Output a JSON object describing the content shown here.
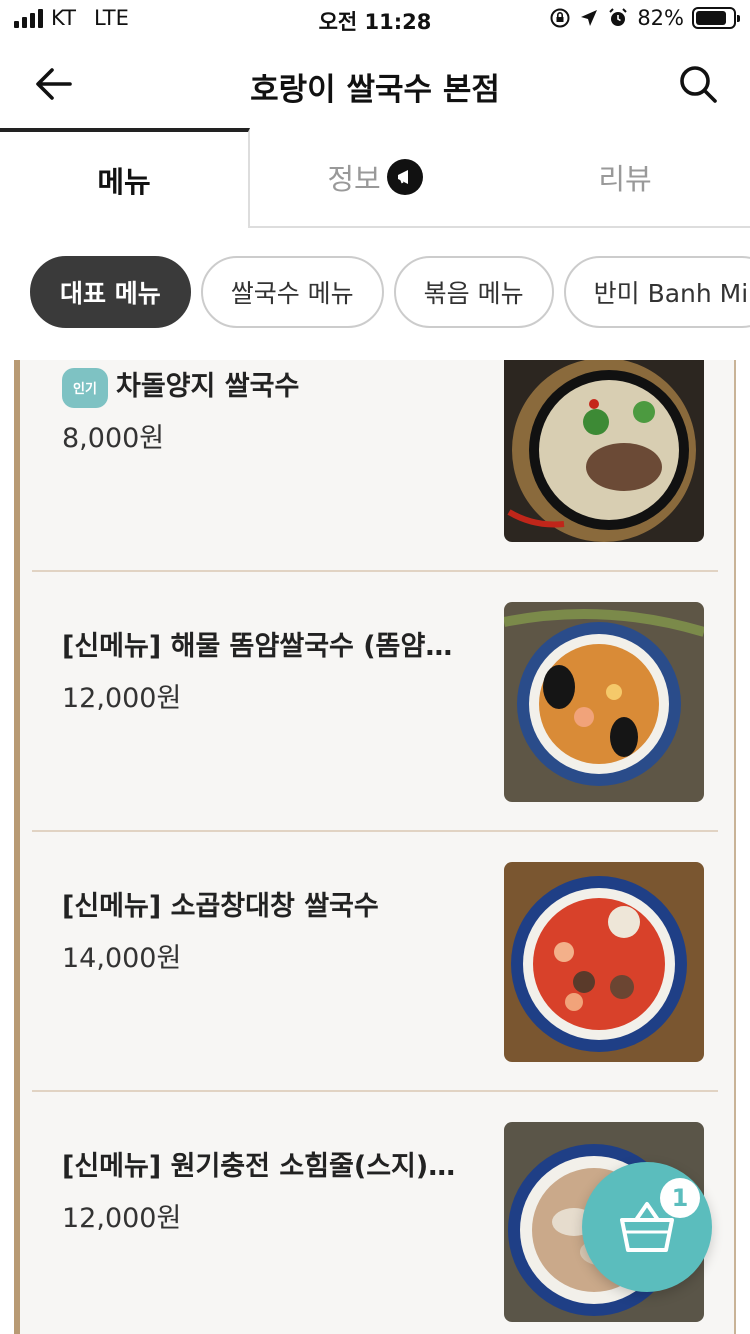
{
  "status_bar": {
    "carrier": "KT",
    "network": "LTE",
    "time": "오전 11:28",
    "battery_percent": "82%",
    "battery_level": 0.82
  },
  "header": {
    "title": "호랑이 쌀국수 본점",
    "back_icon": "arrow-left-icon",
    "search_icon": "search-icon"
  },
  "tabs": [
    {
      "label": "메뉴",
      "active": true
    },
    {
      "label": "정보",
      "active": false,
      "badge_icon": "megaphone-icon"
    },
    {
      "label": "리뷰",
      "active": false
    }
  ],
  "chips": [
    {
      "label": "대표 메뉴",
      "active": true
    },
    {
      "label": "쌀국수 메뉴",
      "active": false
    },
    {
      "label": "볶음 메뉴",
      "active": false
    },
    {
      "label": "반미 Banh Mi",
      "active": false
    }
  ],
  "menu_items": [
    {
      "name": "차돌양지 쌀국수",
      "price": "8,000원",
      "popular": true,
      "popular_label": "인기"
    },
    {
      "name": "[신메뉴] 해물 똠얌쌀국수 (똠얌꿍)",
      "price": "12,000원",
      "popular": false
    },
    {
      "name": "[신메뉴] 소곱창대창 쌀국수",
      "price": "14,000원",
      "popular": false
    },
    {
      "name": "[신메뉴] 원기충전 소힘줄(스지) 쌀국수",
      "price": "12,000원",
      "popular": false
    }
  ],
  "cart": {
    "count": "1",
    "icon": "basket-icon"
  },
  "colors": {
    "accent": "#5bbdbd",
    "frame": "#b89a74",
    "chip_active": "#3a3a3a"
  }
}
